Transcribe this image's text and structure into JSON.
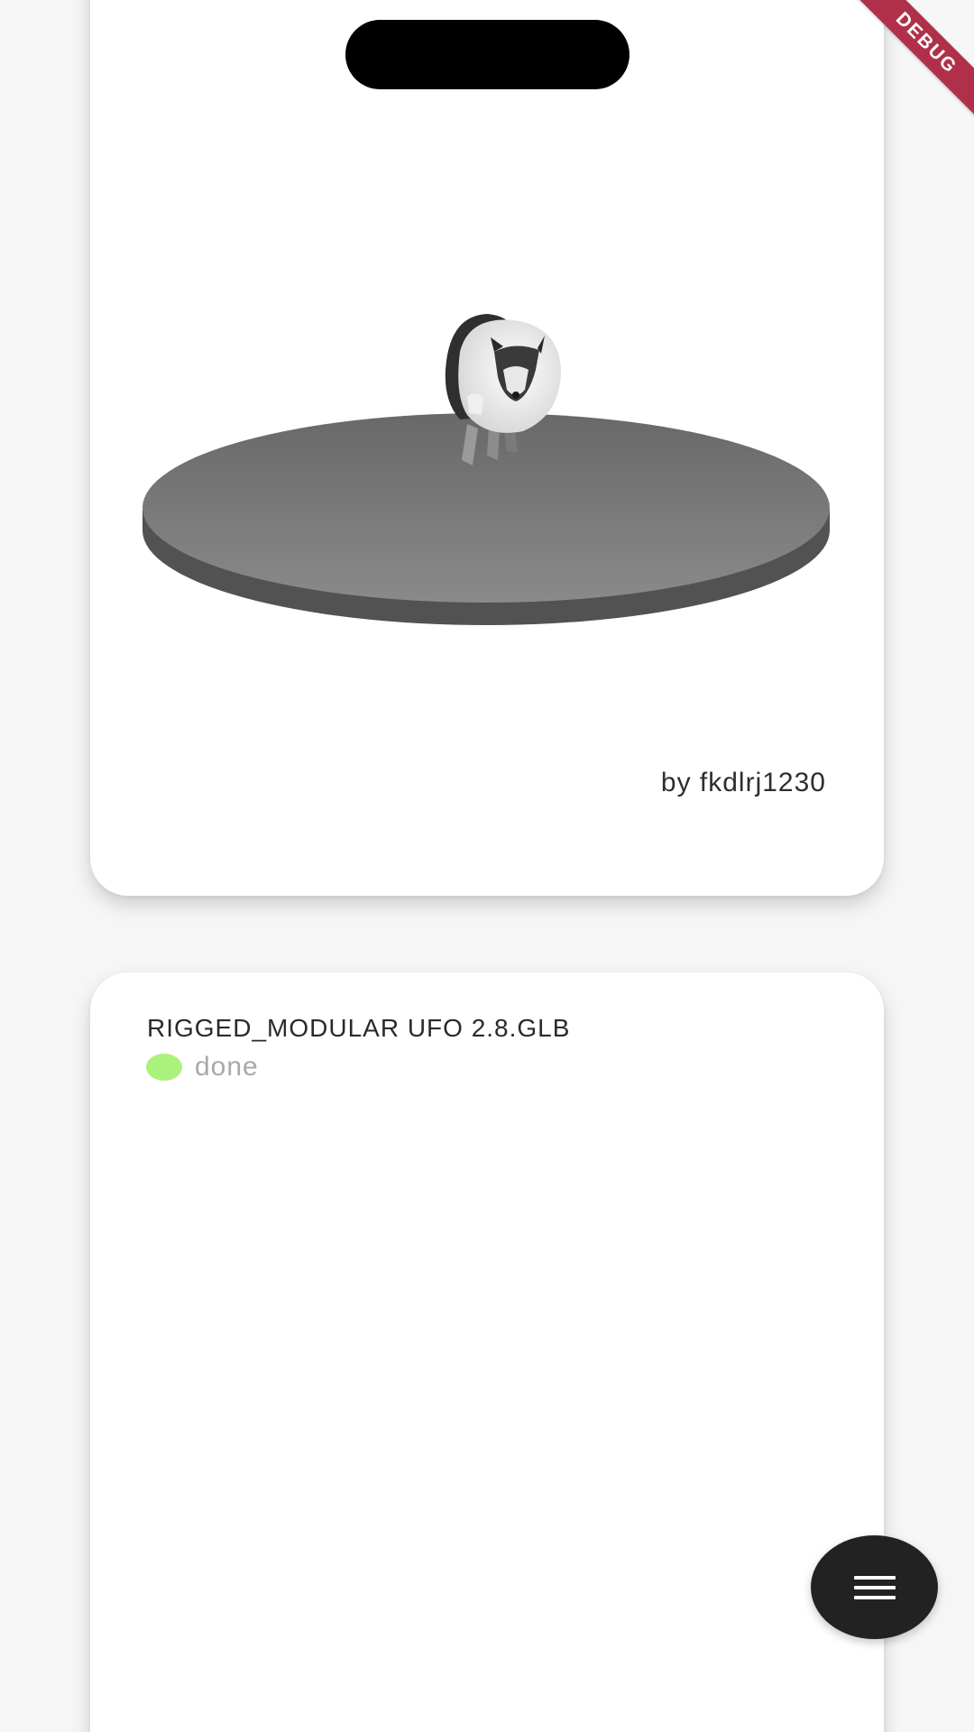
{
  "debug_banner": {
    "label": "DEBUG",
    "color": "#b0304a"
  },
  "cards": [
    {
      "author": "by fkdlrj1230",
      "preview_icon": "husky-on-platform-model"
    },
    {
      "title": "RIGGED_MODULAR UFO 2.8.GLB",
      "status": {
        "label": "done",
        "color": "#aaf27c"
      }
    }
  ],
  "fab": {
    "icon": "hamburger-menu-icon",
    "color": "#222222"
  }
}
